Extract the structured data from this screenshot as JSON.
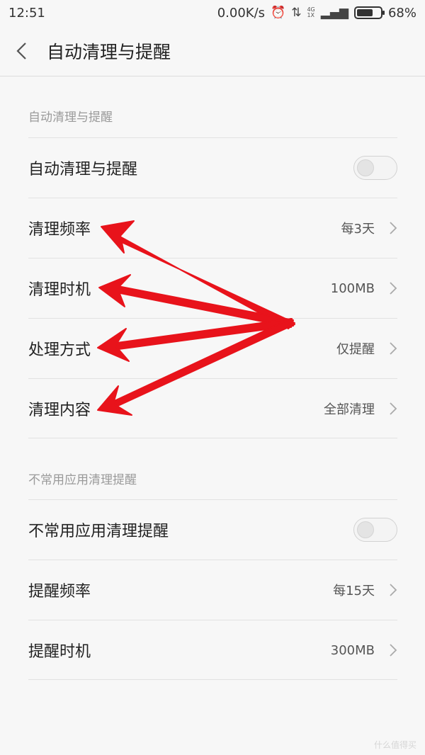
{
  "status_bar": {
    "time": "12:51",
    "net_speed": "0.00K/s",
    "alarm_icon": "alarm-clock-icon",
    "data_icon": "data-arrows-icon",
    "signal_icon": "signal-bars-icon",
    "network_top": "4G",
    "network_bottom": "1X",
    "battery_percent": "68%",
    "battery_level": 0.68
  },
  "header": {
    "back_icon": "chevron-left-icon",
    "title": "自动清理与提醒"
  },
  "sections": [
    {
      "header": "自动清理与提醒",
      "rows": [
        {
          "label": "自动清理与提醒",
          "type": "toggle",
          "on": false
        },
        {
          "label": "清理频率",
          "value": "每3天",
          "type": "nav"
        },
        {
          "label": "清理时机",
          "value": "100MB",
          "type": "nav"
        },
        {
          "label": "处理方式",
          "value": "仅提醒",
          "type": "nav"
        },
        {
          "label": "清理内容",
          "value": "全部清理",
          "type": "nav"
        }
      ]
    },
    {
      "header": "不常用应用清理提醒",
      "rows": [
        {
          "label": "不常用应用清理提醒",
          "type": "toggle",
          "on": false
        },
        {
          "label": "提醒频率",
          "value": "每15天",
          "type": "nav"
        },
        {
          "label": "提醒时机",
          "value": "300MB",
          "type": "nav"
        }
      ]
    }
  ],
  "annotation": {
    "color": "#e8131b"
  },
  "watermark": "什么值得买"
}
